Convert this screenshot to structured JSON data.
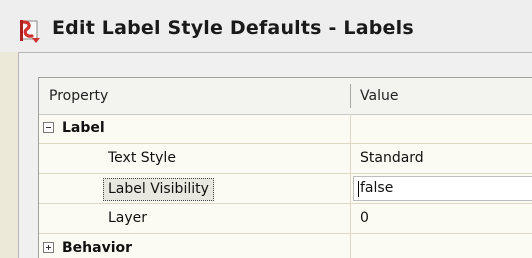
{
  "window": {
    "title": "Edit Label Style Defaults - Labels",
    "icon": "civil-label-style-icon",
    "accent": "#d0312d"
  },
  "grid": {
    "headers": {
      "property": "Property",
      "value": "Value"
    },
    "categories": [
      {
        "name": "Label",
        "expanded": true,
        "rows": [
          {
            "property": "Text Style",
            "value": "Standard"
          },
          {
            "property": "Label Visibility",
            "value": "false",
            "selected": true
          },
          {
            "property": "Layer",
            "value": "0"
          }
        ]
      },
      {
        "name": "Behavior",
        "expanded": false
      }
    ]
  }
}
